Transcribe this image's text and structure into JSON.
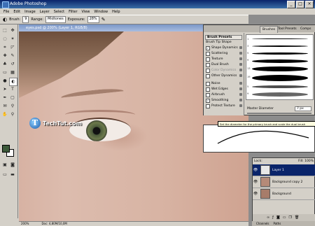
{
  "window": {
    "title": "Adobe Photoshop",
    "min": "_",
    "max": "□",
    "close": "×"
  },
  "menu": [
    "File",
    "Edit",
    "Image",
    "Layer",
    "Select",
    "Filter",
    "View",
    "Window",
    "Help"
  ],
  "options": {
    "brush_label": "Brush:",
    "brush_size": "9",
    "range_label": "Range:",
    "range_value": "Midtones",
    "exposure_label": "Exposure:",
    "exposure_value": "28%"
  },
  "document": {
    "title": "eyes.psd @ 200% (Layer 1, RGB/8)"
  },
  "watermark": {
    "logo": "T",
    "text": "TechTut.com"
  },
  "status": {
    "zoom": "200%",
    "doc": "Doc: 4,80M/10,0M"
  },
  "brushes": {
    "tabs": [
      "Brushes",
      "Tool Presets",
      "Comps"
    ],
    "header": "Brush Presets",
    "subheader": "Brush Tip Shape",
    "items": [
      {
        "label": "Shape Dynamics",
        "checked": true
      },
      {
        "label": "Scattering",
        "checked": false
      },
      {
        "label": "Texture",
        "checked": false
      },
      {
        "label": "Dual Brush",
        "checked": false
      },
      {
        "label": "Color Dynamics",
        "checked": false
      },
      {
        "label": "Other Dynamics",
        "checked": false
      },
      {
        "label": "Noise",
        "checked": false
      },
      {
        "label": "Wet Edges",
        "checked": false
      },
      {
        "label": "Airbrush",
        "checked": false
      },
      {
        "label": "Smoothing",
        "checked": true
      },
      {
        "label": "Protect Texture",
        "checked": false
      }
    ],
    "stroke_sizes": [
      "1",
      "3",
      "5",
      "9",
      "13",
      "19",
      "5",
      "9"
    ],
    "diameter_label": "Master Diameter",
    "diameter_value": "7 px"
  },
  "tooltip": "Set the diameter for the primary brush and scale the dual brush",
  "layers": {
    "lock_label": "Lock:",
    "fill_label": "Fill:",
    "fill_value": "100%",
    "rows": [
      {
        "name": "Layer 1",
        "selected": true
      },
      {
        "name": "Background copy 2",
        "selected": false
      },
      {
        "name": "Background",
        "selected": false
      }
    ],
    "tabs": [
      "Channels",
      "Paths"
    ]
  }
}
